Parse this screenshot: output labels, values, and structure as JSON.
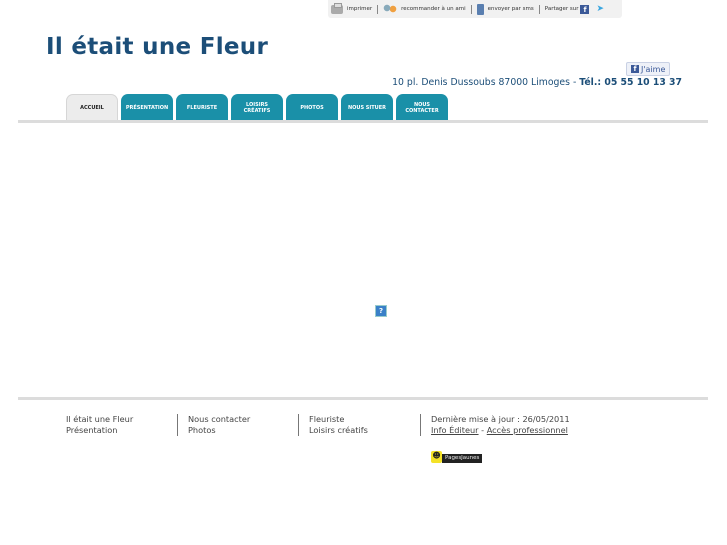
{
  "toolbar": {
    "print": "imprimer",
    "recommend": "recommander à un ami",
    "sms": "envoyer par sms",
    "share": "Partager sur"
  },
  "header": {
    "title": "Il était une Fleur",
    "like": "J'aime",
    "address": "10 pl. Denis Dussoubs 87000 Limoges  - ",
    "phone_label": "Tél.: 05 55 10 13 37"
  },
  "nav": {
    "tabs": [
      {
        "label": "ACCUEIL",
        "active": true
      },
      {
        "label": "PRÉSENTATION"
      },
      {
        "label": "FLEURISTE"
      },
      {
        "label": "LOISIRS CRÉATIFS"
      },
      {
        "label": "PHOTOS"
      },
      {
        "label": "NOUS SITUER"
      },
      {
        "label": "NOUS CONTACTER"
      }
    ]
  },
  "main": {
    "plugin_placeholder": "?"
  },
  "footer": {
    "col1": [
      "Il était une Fleur",
      "Présentation"
    ],
    "col2": [
      "Nous contacter",
      "Photos"
    ],
    "col3": [
      "Fleuriste",
      "Loisirs créatifs"
    ],
    "updated": "Dernière mise à jour : 26/05/2011",
    "info_editeur": "Info Éditeur",
    "dash": " - ",
    "acces_pro": "Accès professionnel",
    "pagesjaunes": "PagesJaunes"
  },
  "colors": {
    "brand": "#1c4e78",
    "tab": "#1a90a8"
  }
}
